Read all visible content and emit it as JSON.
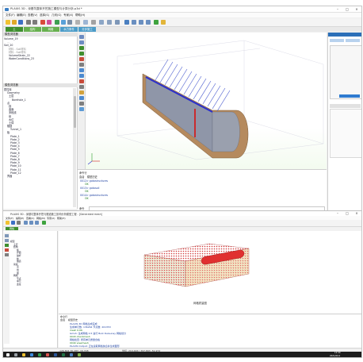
{
  "top_window": {
    "title": "PLAXIS 3D - 深基坑整体开挖施工模型与计算分析.p3d *",
    "menu": [
      "文件(F)",
      "编辑(E)",
      "查看(V)",
      "选择(S)",
      "几何(G)",
      "专家(X)",
      "帮助(H)"
    ],
    "tabs": [
      "土",
      "结构",
      "网格",
      "水力条件",
      "分步施工"
    ],
    "model_explorer_title": "模型浏览器",
    "model_explorer_items": [
      "Volume_19",
      "...",
      "Soil_20",
      "材料 - Soil材料",
      "材料 - Soil材料",
      "VolumeStrain_22",
      "WaterConditions_23"
    ],
    "selection_title": "模型浏览器",
    "selection_items": [
      "属性库",
      "Geometry",
      "土层",
      "Borehole_1",
      "点",
      "线",
      "曲面",
      "多段线",
      "体",
      "水位",
      "土体",
      "隧道",
      "Tunnel_1",
      "板",
      "Plate_1",
      "Plate_2",
      "Plate_3",
      "Plate_4",
      "Plate_5",
      "Plate_6",
      "Plate_7",
      "Plate_8",
      "Plate_9",
      "Plate_10",
      "Plate_11",
      "Plate_12",
      "界面"
    ],
    "command_title": "命令行",
    "command_tabs": [
      "会话",
      "模型历史"
    ],
    "command_lines": [
      "0012> gotostructures",
      "OK",
      "0013> gotosoil",
      "OK",
      "0014> gotostructures",
      "OK"
    ],
    "command_prompt": "命令"
  },
  "bottom_window": {
    "title": "PLAXIS 3D - 深基坑整体开挖与隧道施工影响分析模型工程 - [Generated mesh]",
    "menu": [
      "文件(F)",
      "编辑(E)",
      "查看(V)",
      "网格(M)",
      "专家(X)",
      "帮助(H)"
    ],
    "tabs": [
      "网格"
    ],
    "explorer_items": [
      "模型",
      "土层",
      "结构",
      "板",
      "界面",
      "锚杆",
      "桩",
      "隧道",
      "荷载",
      "点",
      "线",
      "面",
      "网格",
      "节点",
      "单元",
      "连接"
    ],
    "view_caption": "网格质量图",
    "command_title": "命令行",
    "command_tabs": [
      "会话",
      "模型历史"
    ],
    "command_lines": [
      "PLAXIS 3D 网格生成完成",
      "生成单元数: 136264  节点数: 201353",
      "mesh 0.06",
      "Gmsh: 生成网格 0.5  进行 Bulk Delaunay 网格划分",
      "0043 checkmesh",
      "网格检查: 所有单元质量合格",
      "0044 viewmesh",
      "PLAXIS Output: 正在读取网格信息并生成图形"
    ]
  },
  "status_bar": {
    "left": "-126.804 30.283 -16.728",
    "center": "坐标: 219.446 | 397.893 -51.972"
  },
  "taskbar": {
    "time": "12:40",
    "date": "2021/6/12"
  },
  "colors": {
    "tab_active": "#3f8f2f",
    "tab_green": "#67b04f",
    "tunnel_brown": "#b58a5e",
    "plate_blue": "#2a2fcc",
    "anchor_blue": "#4a5ccf"
  }
}
